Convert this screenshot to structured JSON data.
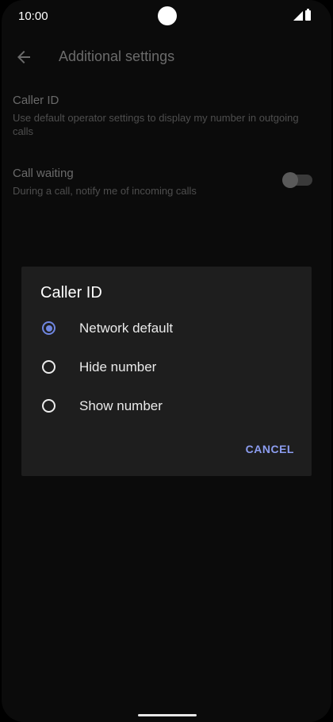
{
  "status_bar": {
    "time": "10:00",
    "icons": [
      "signal-icon",
      "battery-icon"
    ]
  },
  "app_bar": {
    "title": "Additional settings",
    "back_icon": "arrow-back-icon"
  },
  "settings": [
    {
      "title": "Caller ID",
      "summary": "Use default operator settings to display my number in outgoing calls"
    },
    {
      "title": "Call waiting",
      "summary": "During a call, notify me of incoming calls",
      "toggle_on": false
    }
  ],
  "dialog": {
    "title": "Caller ID",
    "options": [
      {
        "label": "Network default",
        "selected": true
      },
      {
        "label": "Hide number",
        "selected": false
      },
      {
        "label": "Show number",
        "selected": false
      }
    ],
    "cancel_label": "CANCEL"
  },
  "colors": {
    "accent": "#6f86e0",
    "dialog_bg": "#1e1e1e",
    "screen_bg": "#0b0b0b"
  }
}
